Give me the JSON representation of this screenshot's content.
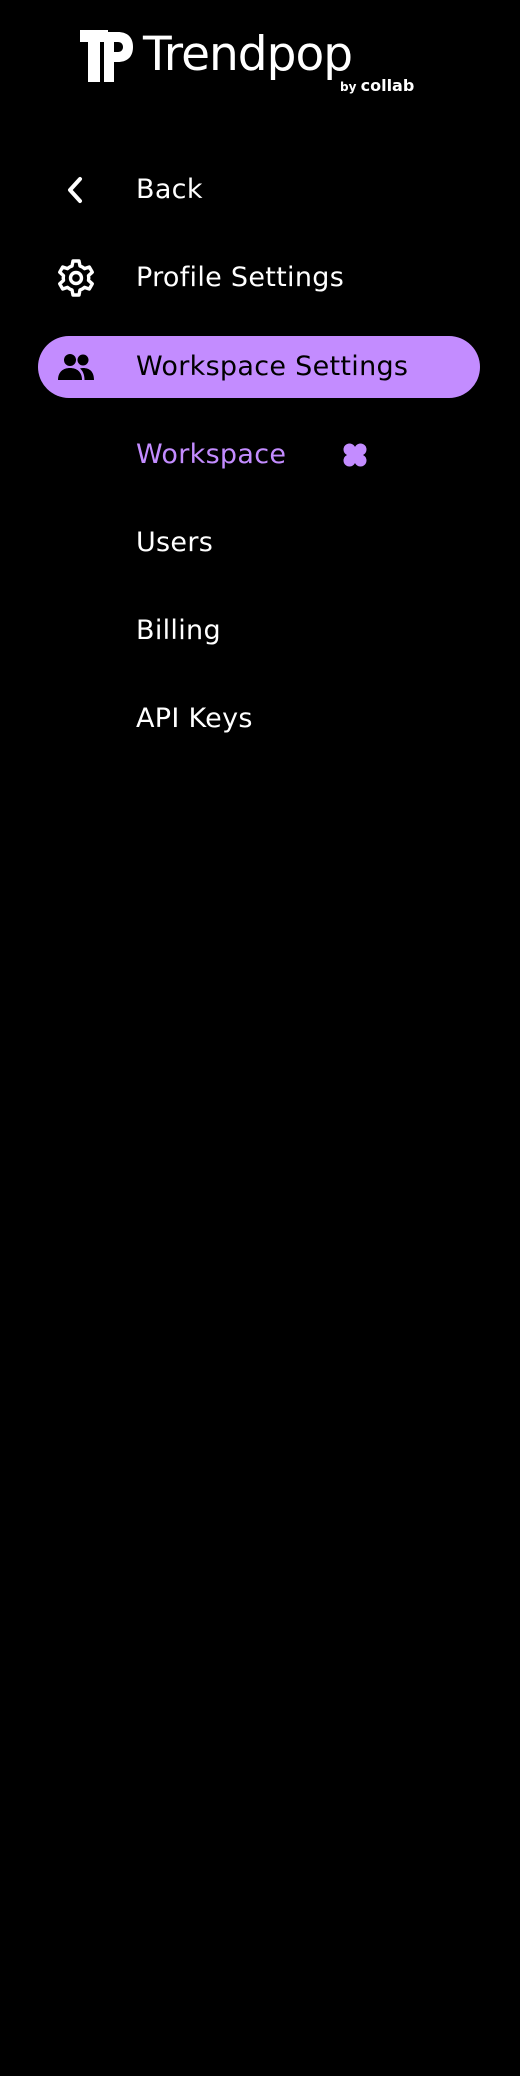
{
  "brand": {
    "name": "Trendpop",
    "by": "by",
    "partner": "collab",
    "logo_icon": "trendpop-tp-logo"
  },
  "colors": {
    "background": "#000000",
    "accent": "#c38cff",
    "text": "#ffffff",
    "active_text": "#000000"
  },
  "nav": {
    "back": {
      "label": "Back",
      "icon": "chevron-left-icon"
    },
    "profile_settings": {
      "label": "Profile Settings",
      "icon": "gear-icon"
    },
    "workspace_settings": {
      "label": "Workspace Settings",
      "icon": "users-icon",
      "active": true
    }
  },
  "subnav": {
    "items": [
      {
        "label": "Workspace",
        "current": true,
        "icon": "clover-icon"
      },
      {
        "label": "Users"
      },
      {
        "label": "Billing"
      },
      {
        "label": "API Keys"
      }
    ]
  }
}
